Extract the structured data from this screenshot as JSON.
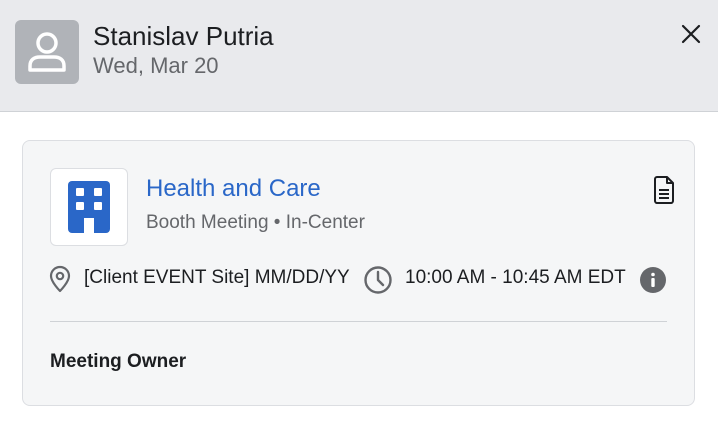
{
  "header": {
    "person_name": "Stanislav Putria",
    "date": "Wed, Mar 20",
    "avatar_icon": "person-icon",
    "close_icon": "close-icon"
  },
  "meeting": {
    "title": "Health and Care",
    "subtitle": "Booth Meeting • In-Center",
    "logo_icon": "building-icon",
    "document_icon": "document-icon",
    "location": "[Client EVENT Site] MM/DD/YY",
    "time": "10:00 AM - 10:45 AM EDT",
    "info_icon": "info-icon",
    "owner_label": "Meeting Owner"
  },
  "colors": {
    "accent": "#2a67c8",
    "header_bg": "#e9eaed",
    "card_bg": "#f5f6f7"
  }
}
